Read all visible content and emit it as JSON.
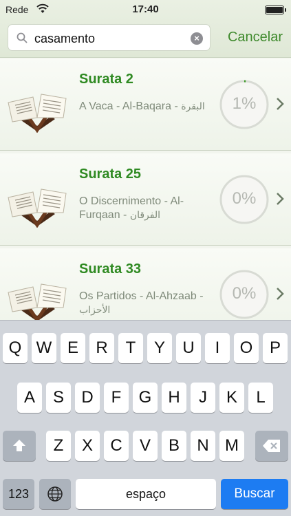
{
  "status_bar": {
    "carrier": "Rede",
    "time": "17:40"
  },
  "search": {
    "value": "casamento",
    "cancel_label": "Cancelar"
  },
  "colors": {
    "accent_green": "#2f8a22",
    "keyboard_blue": "#1d7cf2"
  },
  "results": [
    {
      "title": "Surata 2",
      "subtitle": "A Vaca - Al-Baqara - ",
      "subtitle_ar": "البقرة",
      "progress_label": "1%",
      "progress": 0.01,
      "icon": "quran-book-icon"
    },
    {
      "title": "Surata 25",
      "subtitle": "O Discernimento - Al-Furqaan - ",
      "subtitle_ar": "الفرقان",
      "progress_label": "0%",
      "progress": 0.0,
      "icon": "quran-book-icon"
    },
    {
      "title": "Surata 33",
      "subtitle": "Os Partidos - Al-Ahzaab - ",
      "subtitle_ar": "الأحزاب",
      "progress_label": "0%",
      "progress": 0.0,
      "icon": "quran-book-icon"
    }
  ],
  "keyboard": {
    "row1": [
      "Q",
      "W",
      "E",
      "R",
      "T",
      "Y",
      "U",
      "I",
      "O",
      "P"
    ],
    "row2": [
      "A",
      "S",
      "D",
      "F",
      "G",
      "H",
      "J",
      "K",
      "L"
    ],
    "row3": [
      "Z",
      "X",
      "C",
      "V",
      "B",
      "N",
      "M"
    ],
    "numbers_label": "123",
    "space_label": "espaço",
    "action_label": "Buscar",
    "icons": {
      "shift": "shift-icon",
      "backspace": "backspace-icon",
      "globe": "globe-icon"
    }
  }
}
